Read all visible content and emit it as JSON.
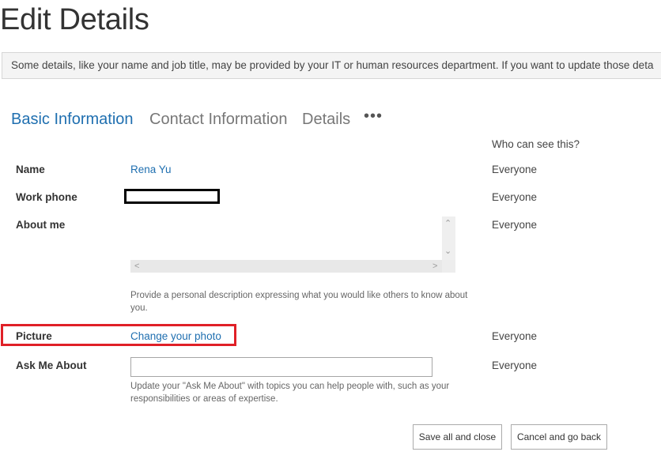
{
  "page": {
    "title": "Edit Details"
  },
  "info_bar": {
    "text": "Some details, like your name and job title, may be provided by your IT or human resources department. If you want to update those deta"
  },
  "tabs": [
    {
      "label": "Basic Information",
      "active": true
    },
    {
      "label": "Contact Information",
      "active": false
    },
    {
      "label": "Details",
      "active": false
    }
  ],
  "tabs_more": {
    "label": "•••"
  },
  "who_can_see": {
    "header": "Who can see this?"
  },
  "fields": {
    "name": {
      "label": "Name",
      "value": "Rena Yu",
      "visibility": "Everyone"
    },
    "work_phone": {
      "label": "Work phone",
      "visibility": "Everyone"
    },
    "about_me": {
      "label": "About me",
      "visibility": "Everyone",
      "help": "Provide a personal description expressing what you would like others to know about you."
    },
    "picture": {
      "label": "Picture",
      "link": "Change your photo",
      "visibility": "Everyone"
    },
    "ask_me_about": {
      "label": "Ask Me About",
      "value": "",
      "visibility": "Everyone",
      "help": "Update your \"Ask Me About\" with topics you can help people with, such as your responsibilities or areas of expertise."
    }
  },
  "buttons": {
    "save": "Save all and close",
    "cancel": "Cancel and go back"
  },
  "colors": {
    "accent": "#1f6fb0",
    "highlight": "#e02027"
  }
}
